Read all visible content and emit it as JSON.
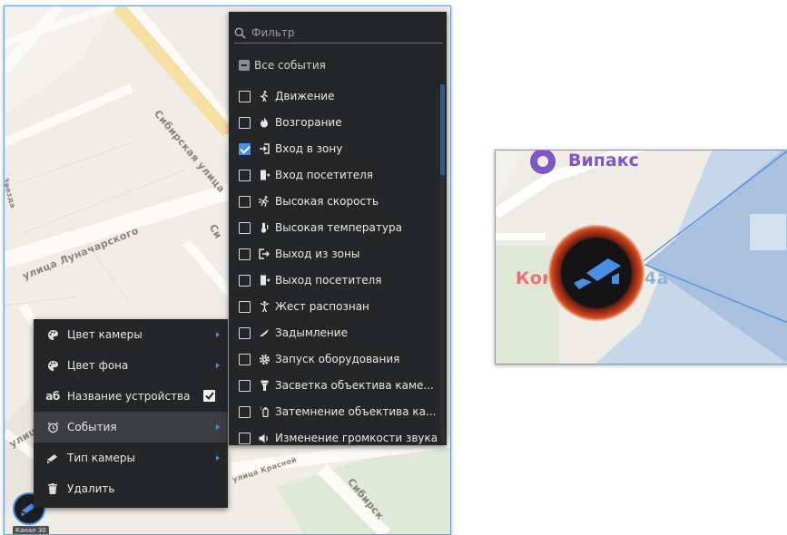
{
  "map": {
    "street_labels": [
      "Сибирская улица",
      "Сибирская улица",
      "Сибирская",
      "улица Луначарского",
      "улица Красной",
      "Си",
      "Звезда",
      "улица",
      "улица Звезда",
      "Сибирск"
    ],
    "camera_caption": "Канал 30"
  },
  "context_menu": {
    "items": [
      {
        "label": "Цвет камеры",
        "icon": "palette-icon",
        "submenu": true
      },
      {
        "label": "Цвет фона",
        "icon": "palette-icon",
        "submenu": true
      },
      {
        "label": "Название устройства",
        "icon": "text-ab-icon",
        "icon_text": "аб",
        "checked": true
      },
      {
        "label": "События",
        "icon": "alarm-clock-icon",
        "submenu": true,
        "active": true
      },
      {
        "label": "Тип камеры",
        "icon": "camera-type-icon",
        "submenu": true
      },
      {
        "label": "Удалить",
        "icon": "trash-icon"
      }
    ]
  },
  "filter_panel": {
    "search_placeholder": "Фильтр",
    "all_events_label": "Все события",
    "events": [
      {
        "label": "Движение",
        "icon": "walking-icon",
        "checked": false
      },
      {
        "label": "Возгорание",
        "icon": "fire-icon",
        "checked": false
      },
      {
        "label": "Вход в зону",
        "icon": "enter-zone-icon",
        "checked": true
      },
      {
        "label": "Вход посетителя",
        "icon": "door-enter-icon",
        "checked": false
      },
      {
        "label": "Высокая скорость",
        "icon": "running-icon",
        "checked": false
      },
      {
        "label": "Высокая температура",
        "icon": "thermometer-icon",
        "checked": false
      },
      {
        "label": "Выход из зоны",
        "icon": "exit-zone-icon",
        "checked": false
      },
      {
        "label": "Выход посетителя",
        "icon": "door-exit-icon",
        "checked": false
      },
      {
        "label": "Жест распознан",
        "icon": "gesture-icon",
        "checked": false
      },
      {
        "label": "Задымление",
        "icon": "smoke-icon",
        "checked": false
      },
      {
        "label": "Запуск оборудования",
        "icon": "gear-icon",
        "checked": false
      },
      {
        "label": "Засветка объектива каме...",
        "icon": "flashlight-icon",
        "checked": false
      },
      {
        "label": "Затемнение объектива ка...",
        "icon": "darken-icon",
        "checked": false
      },
      {
        "label": "Изменение громкости звука",
        "icon": "volume-icon",
        "checked": false
      }
    ]
  },
  "zoom": {
    "label_top": "Випакс",
    "label_mid_left": "Ком",
    "label_mid_right": "4а"
  },
  "colors": {
    "menu_bg": "#252628",
    "accent": "#4a8fe6",
    "active_row": "#3d3e41",
    "marker_ring": "#c8401b"
  }
}
